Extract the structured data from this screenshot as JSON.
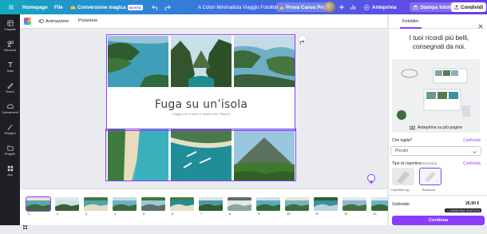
{
  "topbar": {
    "home": "Homepage",
    "file": "File",
    "magic": "Conversione magica",
    "magic_badge": "NOVITÀ",
    "doc_title": "A Colori Minimalista Viaggio Fotolibri",
    "try_pro": "Prova Canva Pro",
    "preview": "Anteprima",
    "print": "Stampa fotolibri",
    "share": "Condividi"
  },
  "sidebar": {
    "items": [
      "Progetta",
      "Elementi",
      "Testo",
      "Brand",
      "Caricamenti",
      "Disegna",
      "Progetti",
      "App"
    ]
  },
  "toolbar": {
    "animate": "Animazione",
    "position": "Posizione"
  },
  "page": {
    "title": "Fuga su un’isola",
    "subtitle": "Viaggio con lo zaino in spalla nelle Filippine"
  },
  "filmstrip": {
    "numbers": [
      "1",
      "2",
      "3",
      "4",
      "5",
      "6",
      "7",
      "8",
      "9",
      "10",
      "11",
      "12",
      "13"
    ]
  },
  "panel": {
    "tab": "Fotolibri",
    "headline": "I tuoi ricordi più belli, consegnati da noi.",
    "preview_more": "Anteprima su più pagine",
    "size_label": "Che taglia?",
    "size_compare": "Confronta",
    "size_value": "Piccolo",
    "cover_label": "Tipo di copertina",
    "cover_sel": "Brossura",
    "cover_compare": "Confronta",
    "cover_opt1": "Copertina rig...",
    "cover_opt2": "Brossura",
    "subtotal_label": "Subtotale",
    "price": "26,90 €",
    "free_delivery": "+ CONSEGNA GRATUITA",
    "continue": "Continua"
  },
  "colors": {
    "accent": "#8b3dff",
    "topbar_start": "#14a7bf",
    "topbar_end": "#6a3ce6",
    "sidebar": "#1d1f22"
  },
  "icons": [
    "canva-logo-icon",
    "undo-icon",
    "redo-icon",
    "crown-icon",
    "plus-icon",
    "bar-chart-icon",
    "play-icon",
    "print-icon",
    "share-icon",
    "close-icon",
    "rotate-icon",
    "book-icon",
    "chevron-down-icon",
    "assistant-icon",
    "grid-icon"
  ]
}
